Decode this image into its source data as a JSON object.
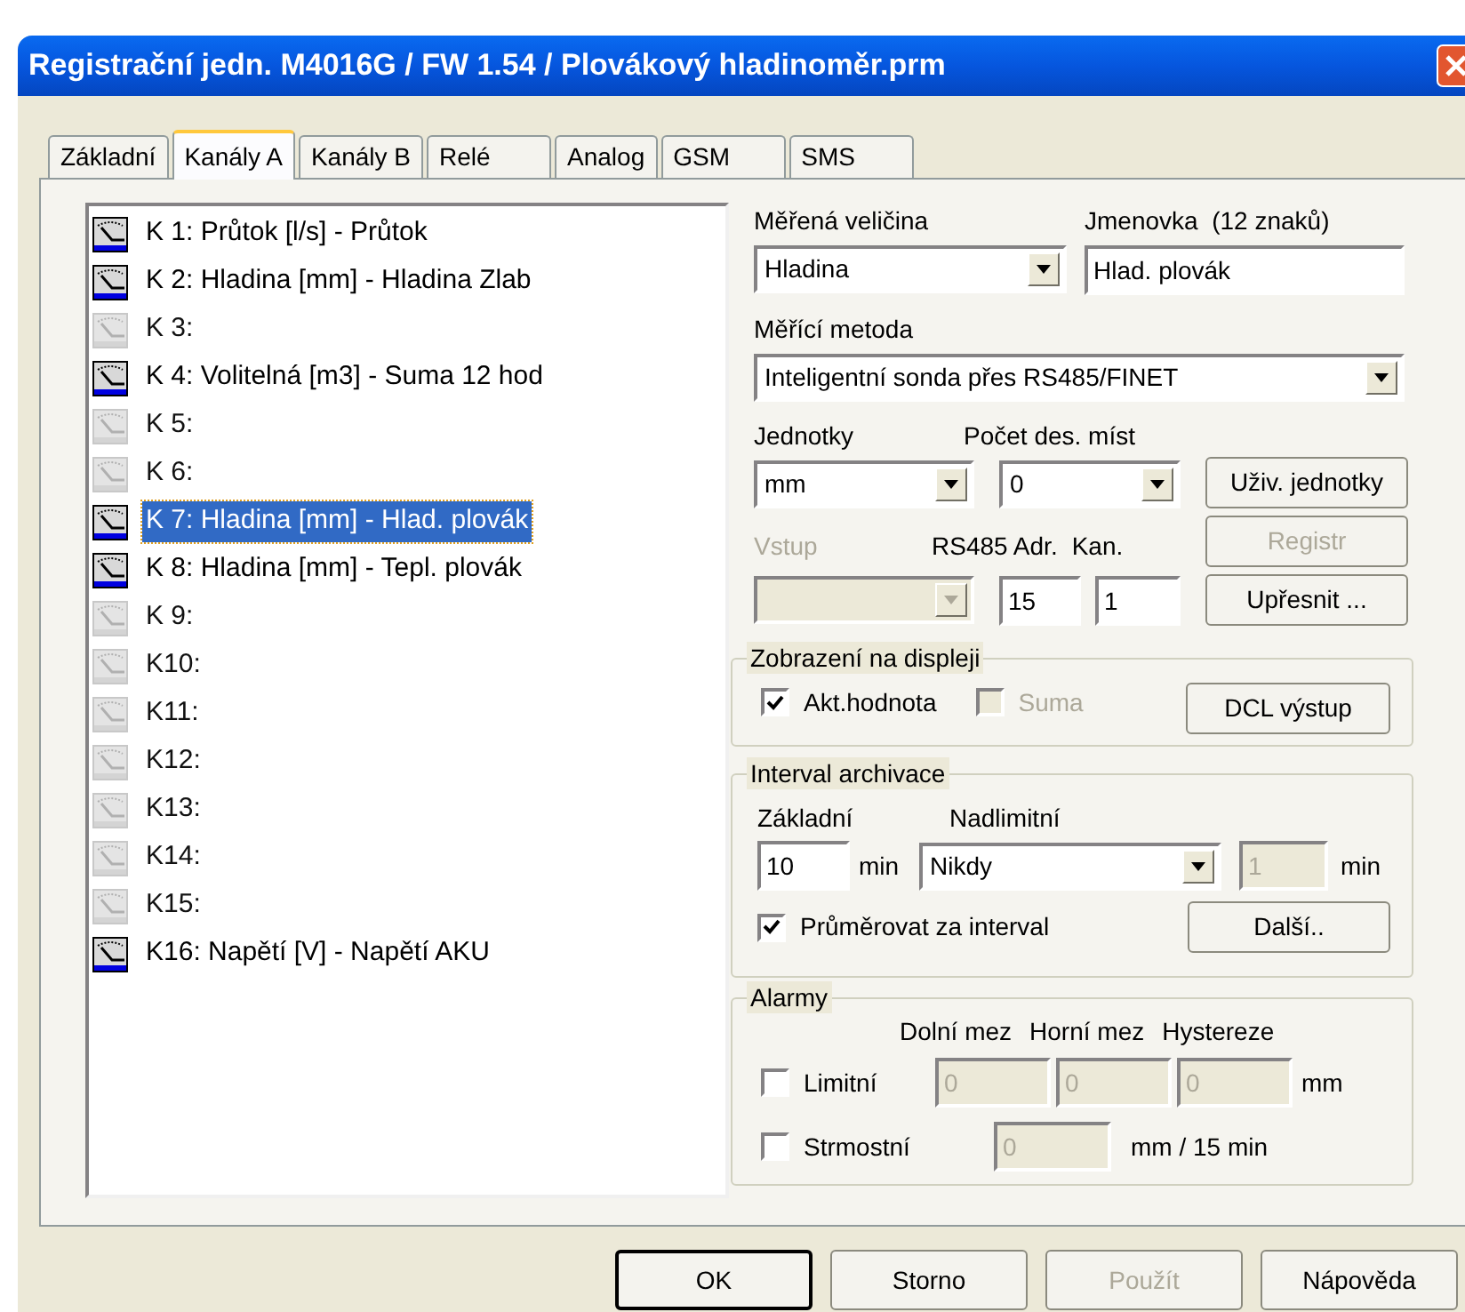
{
  "window": {
    "title": "Registrační jedn. M4016G / FW 1.54 / Plovákový hladinoměr.prm"
  },
  "tabs": [
    {
      "label": "Základní",
      "selected": false
    },
    {
      "label": "Kanály A",
      "selected": true
    },
    {
      "label": "Kanály B",
      "selected": false
    },
    {
      "label": "Relé",
      "selected": false
    },
    {
      "label": "Analog",
      "selected": false
    },
    {
      "label": "GSM",
      "selected": false
    },
    {
      "label": "SMS",
      "selected": false
    }
  ],
  "channels": [
    {
      "label": "K 1: Průtok [l/s] - Průtok",
      "active": true,
      "selected": false
    },
    {
      "label": "K 2: Hladina [mm] - Hladina Zlab",
      "active": true,
      "selected": false
    },
    {
      "label": "K 3:",
      "active": false,
      "selected": false
    },
    {
      "label": "K 4: Volitelná [m3] - Suma 12 hod",
      "active": true,
      "selected": false
    },
    {
      "label": "K 5:",
      "active": false,
      "selected": false
    },
    {
      "label": "K 6:",
      "active": false,
      "selected": false
    },
    {
      "label": "K 7: Hladina [mm] - Hlad. plovák",
      "active": true,
      "selected": true
    },
    {
      "label": "K 8: Hladina [mm] - Tepl. plovák",
      "active": true,
      "selected": false
    },
    {
      "label": "K 9:",
      "active": false,
      "selected": false
    },
    {
      "label": "K10:",
      "active": false,
      "selected": false
    },
    {
      "label": "K11:",
      "active": false,
      "selected": false
    },
    {
      "label": "K12:",
      "active": false,
      "selected": false
    },
    {
      "label": "K13:",
      "active": false,
      "selected": false
    },
    {
      "label": "K14:",
      "active": false,
      "selected": false
    },
    {
      "label": "K15:",
      "active": false,
      "selected": false
    },
    {
      "label": "K16: Napětí [V] - Napětí AKU",
      "active": true,
      "selected": false
    }
  ],
  "quantity": {
    "label": "Měřená veličina",
    "value": "Hladina"
  },
  "name_tag": {
    "label": "Jmenovka  (12 znaků)",
    "value": "Hlad. plovák"
  },
  "method": {
    "label": "Měřící metoda",
    "value": "Inteligentní sonda přes RS485/FINET"
  },
  "units": {
    "label": "Jednotky",
    "value": "mm"
  },
  "decimals": {
    "label": "Počet des. míst",
    "value": "0"
  },
  "user_units_button": {
    "label": "Uživ. jednotky",
    "disabled": false
  },
  "register_button": {
    "label": "Registr",
    "disabled": true
  },
  "input": {
    "label": "Vstup",
    "disabled": true
  },
  "rs485_address": {
    "label": "RS485 Adr.",
    "value": "15"
  },
  "channel_no": {
    "label": "Kan.",
    "value": "1"
  },
  "refine_button": {
    "label": "Upřesnit ...",
    "disabled": false
  },
  "display": {
    "title": "Zobrazení na displeji",
    "checks": [
      {
        "label": "Akt.hodnota",
        "checked": true,
        "disabled": false
      },
      {
        "label": "Suma",
        "checked": false,
        "disabled": true
      }
    ],
    "button": {
      "label": "DCL výstup",
      "disabled": false
    }
  },
  "interval": {
    "title": "Interval archivace",
    "basic_label": "Základní",
    "basic_value": "10",
    "basic_unit": "min",
    "over_label": "Nadlimitní",
    "over_value": "Nikdy",
    "over_field": {
      "value": "1",
      "disabled": true
    },
    "over_unit": "min",
    "average": {
      "label": "Průměrovat za interval",
      "checked": true,
      "disabled": false
    },
    "more_button": {
      "label": "Další..",
      "disabled": false
    }
  },
  "alarms": {
    "title": "Alarmy",
    "columns": [
      "Dolní mez",
      "Horní mez",
      "Hystereze"
    ],
    "limit": {
      "label": "Limitní",
      "checked": false,
      "disabled": false,
      "values": [
        {
          "value": "0",
          "disabled": true
        },
        {
          "value": "0",
          "disabled": true
        },
        {
          "value": "0",
          "disabled": true
        }
      ],
      "unit": "mm"
    },
    "slope": {
      "label": "Strmostní",
      "checked": false,
      "disabled": false,
      "value": {
        "value": "0",
        "disabled": true
      },
      "unit": "mm / 15 min"
    }
  },
  "buttons": [
    {
      "label": "OK",
      "default": true,
      "disabled": false
    },
    {
      "label": "Storno",
      "default": false,
      "disabled": false
    },
    {
      "label": "Použít",
      "default": false,
      "disabled": true
    },
    {
      "label": "Nápověda",
      "default": false,
      "disabled": false
    }
  ]
}
